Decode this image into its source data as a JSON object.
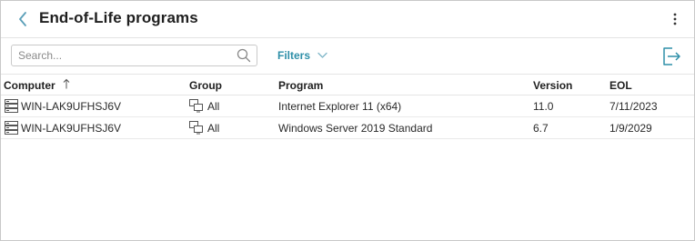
{
  "header": {
    "title": "End-of-Life programs"
  },
  "toolbar": {
    "search_placeholder": "Search...",
    "filters_label": "Filters"
  },
  "table": {
    "columns": {
      "computer": "Computer",
      "group": "Group",
      "program": "Program",
      "version": "Version",
      "eol": "EOL"
    },
    "rows": [
      {
        "computer": "WIN-LAK9UFHSJ6V",
        "group": "All",
        "program": "Internet Explorer 11 (x64)",
        "version": "11.0",
        "eol": "7/11/2023"
      },
      {
        "computer": "WIN-LAK9UFHSJ6V",
        "group": "All",
        "program": "Windows Server 2019 Standard",
        "version": "6.7",
        "eol": "1/9/2029"
      }
    ]
  },
  "icons": {
    "back": "chevron-left-icon",
    "menu": "kebab-menu-icon",
    "search": "search-icon",
    "filters": "chevron-down-icon",
    "export": "export-icon",
    "sort": "sort-ascending-icon",
    "computer": "server-icon",
    "group": "group-icon"
  },
  "colors": {
    "accent": "#2e8fa8",
    "back_arrow": "#5a9fb8",
    "text": "#222222",
    "border": "#c9c9c9"
  }
}
